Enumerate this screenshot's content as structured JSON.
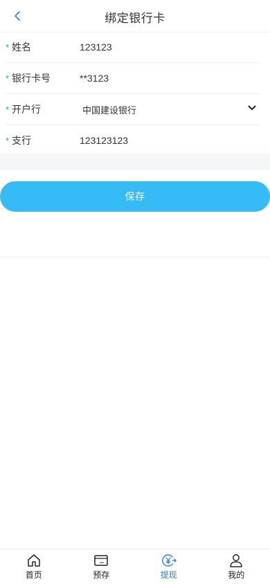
{
  "header": {
    "title": "绑定银行卡",
    "back_icon": "chevron-left-icon"
  },
  "form": {
    "name": {
      "required_mark": "*",
      "label": "姓名",
      "value": "123123"
    },
    "card_number": {
      "required_mark": "*",
      "label": "银行卡号",
      "value": "**3123"
    },
    "bank": {
      "required_mark": "*",
      "label": "开户行",
      "selected": "中国建设银行"
    },
    "branch": {
      "required_mark": "*",
      "label": "支行",
      "value": "123123123"
    }
  },
  "save_button": {
    "label": "保存"
  },
  "tabbar": {
    "items": [
      {
        "label": "首页",
        "icon": "home-icon"
      },
      {
        "label": "预存",
        "icon": "wallet-icon"
      },
      {
        "label": "提现",
        "icon": "withdraw-yen-icon",
        "active": true
      },
      {
        "label": "我的",
        "icon": "user-icon"
      }
    ]
  },
  "colors": {
    "accent": "#35bbf5",
    "active_tab": "#2f7fd6",
    "required_mark": "#2fa0d8",
    "band": "#f5f6f8"
  }
}
